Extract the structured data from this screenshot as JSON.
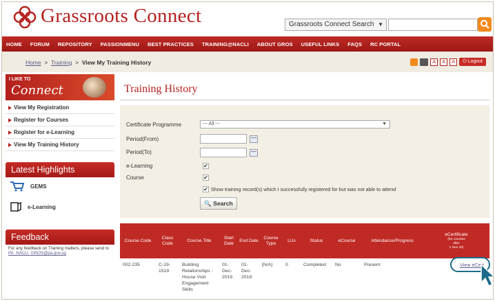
{
  "brand": {
    "name": "Grassroots Connect"
  },
  "search": {
    "scope": "Grassroots Connect Search"
  },
  "nav": [
    "HOME",
    "FORUM",
    "REPOSITORY",
    "PASSIONMENU",
    "BEST PRACTICES",
    "TRAINING@NACLI",
    "ABOUT GROS",
    "USEFUL LINKS",
    "FAQS",
    "RC PORTAL"
  ],
  "breadcrumb": {
    "home": "Home",
    "sep1": ">",
    "training": "Training",
    "sep2": ">",
    "current": "View My Training History"
  },
  "toolbar": {
    "font_a": "A",
    "logout": "Logout"
  },
  "sidebar": {
    "banner_small": "I LIKE TO",
    "banner_big": "Connect",
    "menu": [
      "View My Registration",
      "Register for Courses",
      "Register for e-Learning",
      "View My Training History"
    ],
    "highlights_title": "Latest Highlights",
    "highlights": [
      "GEMS",
      "e-Learning"
    ],
    "feedback_title": "Feedback",
    "feedback_text": "For any feedback on Training matters, please send to",
    "feedback_email": "PA_NACLI_GROS@pa.gov.sg"
  },
  "main": {
    "title": "Training History",
    "form": {
      "cert_label": "Certificate Programme",
      "cert_value": "--- All ---",
      "from_label": "Period(From)",
      "to_label": "Period(To)",
      "elearning_label": "e-Learning",
      "course_label": "Course",
      "note": "Show training record(s) which I successfully registered for but was not able to attend",
      "search_label": "Search"
    },
    "table": {
      "headers": [
        "Course Code",
        "Class Code",
        "Course Title",
        "Start Date",
        "End Date",
        "Course Type",
        "LUs",
        "Status",
        "eCourse",
        "Attendance/Progress",
        "eCertificate"
      ],
      "ecert_note_1": "(for courses",
      "ecert_note_2": "after",
      "ecert_note_3": "1 Nov 18)",
      "row": [
        "002-235",
        "C-19-1519",
        "Building Relationships - House Visit Engagement Skills",
        "01-Dec-2019",
        "01-Dec-2019",
        "[N/A]",
        "0",
        "Completed",
        "No",
        "Present"
      ],
      "link": "View eCert"
    }
  }
}
